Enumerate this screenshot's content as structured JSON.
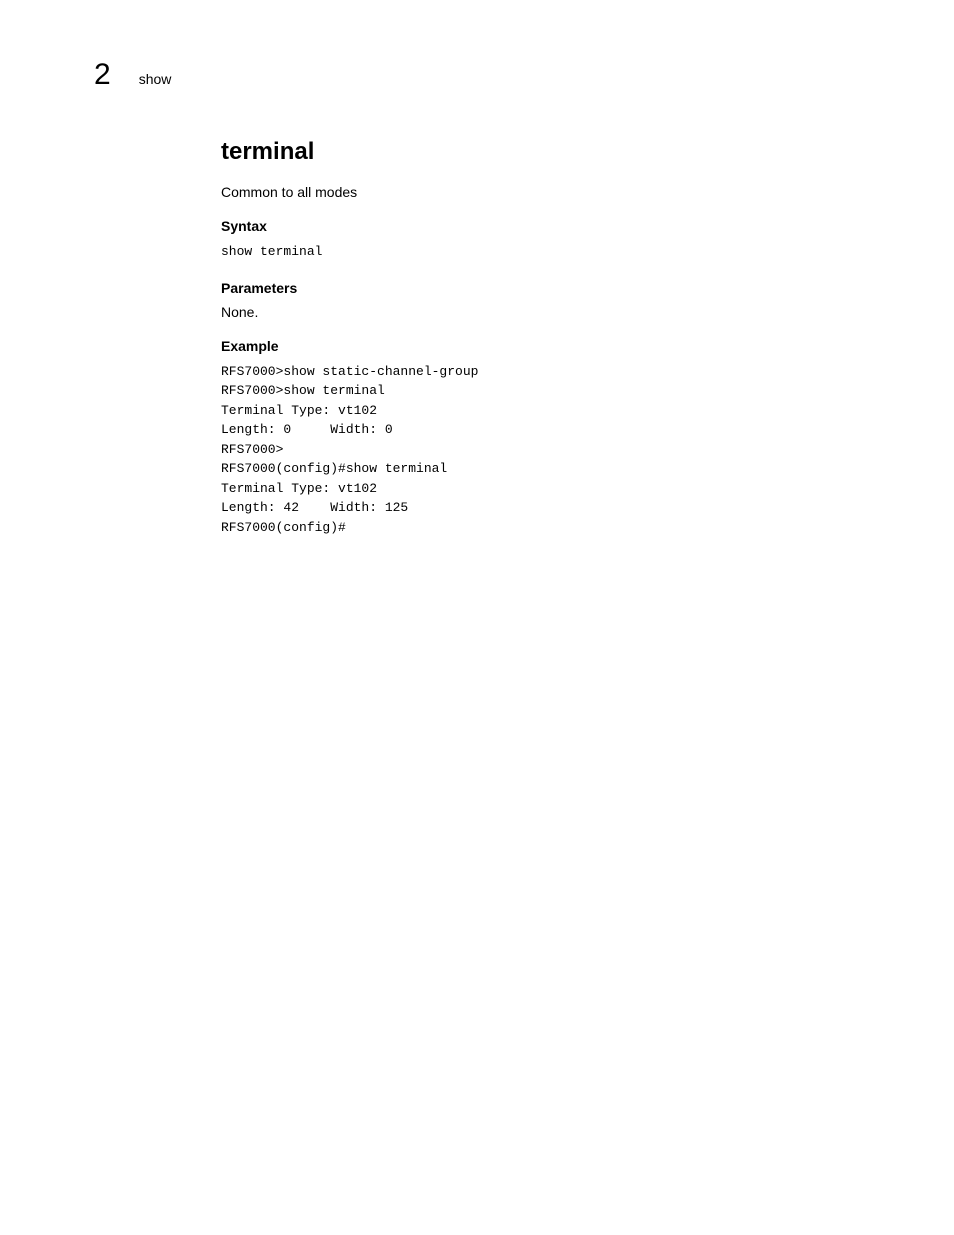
{
  "header": {
    "chapter_number": "2",
    "section_name": "show"
  },
  "content": {
    "title": "terminal",
    "description": "Common to all modes",
    "syntax": {
      "heading": "Syntax",
      "code": "show terminal"
    },
    "parameters": {
      "heading": "Parameters",
      "value": "None."
    },
    "example": {
      "heading": "Example",
      "code": "RFS7000>show static-channel-group\nRFS7000>show terminal\nTerminal Type: vt102\nLength: 0     Width: 0\nRFS7000>\nRFS7000(config)#show terminal\nTerminal Type: vt102\nLength: 42    Width: 125\nRFS7000(config)#"
    }
  }
}
